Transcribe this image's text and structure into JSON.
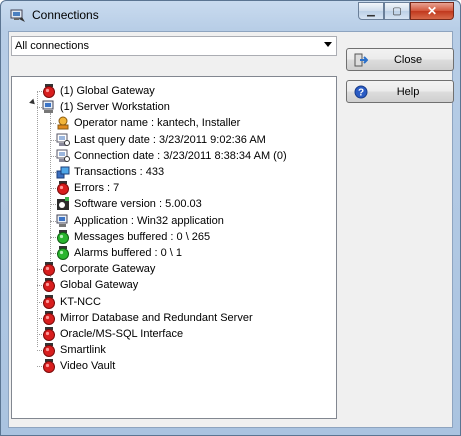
{
  "window": {
    "title": "Connections"
  },
  "filter": {
    "selected": "All connections"
  },
  "buttons": {
    "close_label": "Close",
    "help_label": "Help"
  },
  "tree": [
    {
      "label": "(1) Global Gateway",
      "icon": "red-status-icon"
    },
    {
      "label": "(1) Server Workstation",
      "icon": "workstation-icon"
    },
    {
      "label": "Operator name : kantech, Installer",
      "icon": "operator-icon"
    },
    {
      "label": "Last query date : 3/23/2011 9:02:36 AM",
      "icon": "query-date-icon"
    },
    {
      "label": "Connection date : 3/23/2011 8:38:34 AM  (0)",
      "icon": "connection-date-icon"
    },
    {
      "label": "Transactions : 433",
      "icon": "transactions-icon"
    },
    {
      "label": "Errors : 7",
      "icon": "red-status-icon"
    },
    {
      "label": "Software version : 5.00.03",
      "icon": "software-icon"
    },
    {
      "label": "Application : Win32 application",
      "icon": "application-icon"
    },
    {
      "label": "Messages buffered : 0 \\ 265",
      "icon": "green-status-icon"
    },
    {
      "label": "Alarms buffered : 0 \\ 1",
      "icon": "green-status-icon"
    },
    {
      "label": "Corporate Gateway",
      "icon": "red-status-icon"
    },
    {
      "label": "Global Gateway",
      "icon": "red-status-icon"
    },
    {
      "label": "KT-NCC",
      "icon": "red-status-icon"
    },
    {
      "label": "Mirror Database and Redundant Server",
      "icon": "red-status-icon"
    },
    {
      "label": "Oracle/MS-SQL Interface",
      "icon": "red-status-icon"
    },
    {
      "label": "Smartlink",
      "icon": "red-status-icon"
    },
    {
      "label": "Video Vault",
      "icon": "red-status-icon"
    }
  ]
}
